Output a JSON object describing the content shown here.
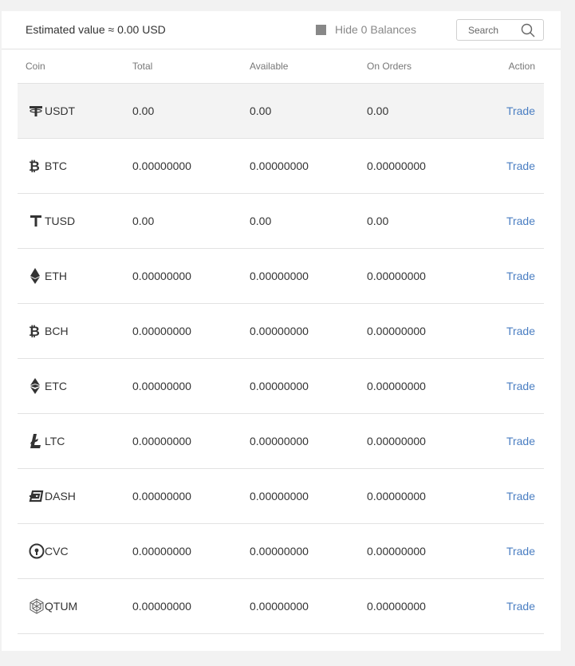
{
  "header": {
    "estimated_value": "Estimated value ≈ 0.00 USD",
    "hide_zero_label": "Hide 0 Balances",
    "search_placeholder": "Search"
  },
  "columns": {
    "coin": "Coin",
    "total": "Total",
    "available": "Available",
    "on_orders": "On Orders",
    "action": "Action"
  },
  "rows": [
    {
      "symbol": "USDT",
      "icon": "tether-icon",
      "total": "0.00",
      "available": "0.00",
      "on_orders": "0.00",
      "action": "Trade"
    },
    {
      "symbol": "BTC",
      "icon": "bitcoin-icon",
      "total": "0.00000000",
      "available": "0.00000000",
      "on_orders": "0.00000000",
      "action": "Trade"
    },
    {
      "symbol": "TUSD",
      "icon": "trueusd-icon",
      "total": "0.00",
      "available": "0.00",
      "on_orders": "0.00",
      "action": "Trade"
    },
    {
      "symbol": "ETH",
      "icon": "ethereum-icon",
      "total": "0.00000000",
      "available": "0.00000000",
      "on_orders": "0.00000000",
      "action": "Trade"
    },
    {
      "symbol": "BCH",
      "icon": "bitcoin-cash-icon",
      "total": "0.00000000",
      "available": "0.00000000",
      "on_orders": "0.00000000",
      "action": "Trade"
    },
    {
      "symbol": "ETC",
      "icon": "ethereum-classic-icon",
      "total": "0.00000000",
      "available": "0.00000000",
      "on_orders": "0.00000000",
      "action": "Trade"
    },
    {
      "symbol": "LTC",
      "icon": "litecoin-icon",
      "total": "0.00000000",
      "available": "0.00000000",
      "on_orders": "0.00000000",
      "action": "Trade"
    },
    {
      "symbol": "DASH",
      "icon": "dash-icon",
      "total": "0.00000000",
      "available": "0.00000000",
      "on_orders": "0.00000000",
      "action": "Trade"
    },
    {
      "symbol": "CVC",
      "icon": "civic-icon",
      "total": "0.00000000",
      "available": "0.00000000",
      "on_orders": "0.00000000",
      "action": "Trade"
    },
    {
      "symbol": "QTUM",
      "icon": "qtum-icon",
      "total": "0.00000000",
      "available": "0.00000000",
      "on_orders": "0.00000000",
      "action": "Trade"
    }
  ],
  "colors": {
    "accent_link": "#4a7ec2",
    "highlight_row": "#f3f3f3"
  }
}
